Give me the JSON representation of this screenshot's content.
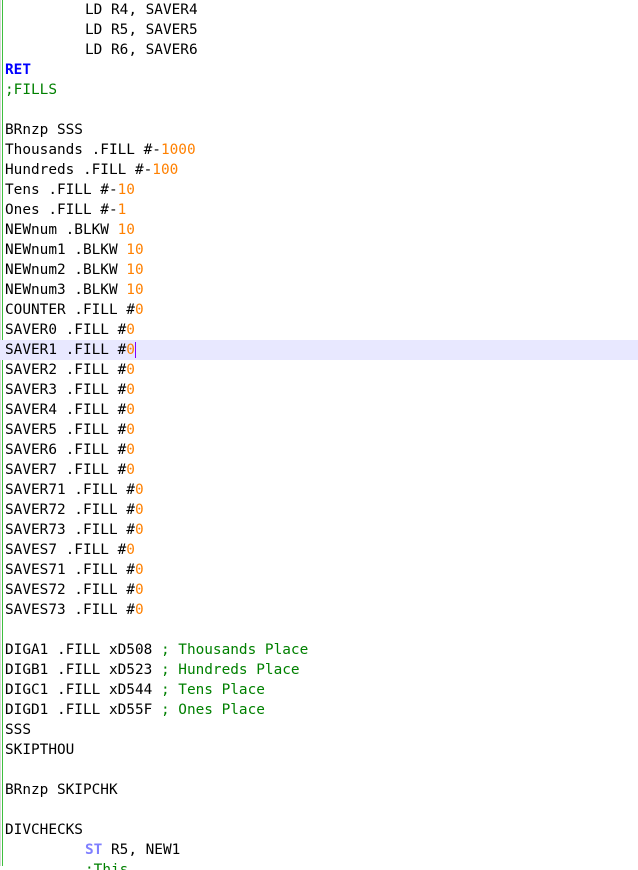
{
  "editor": {
    "theme": {
      "keyword": "#0000ff",
      "keyword_alt": "#8080ff",
      "comment": "#008000",
      "number": "#ff8000",
      "text": "#000000",
      "current_line": "#e8e8ff"
    },
    "lines": [
      {
        "indent": true,
        "text": "LD R4, SAVER4"
      },
      {
        "indent": true,
        "text": "LD R5, SAVER5"
      },
      {
        "indent": true,
        "text": "LD R6, SAVER6"
      },
      {
        "kw": "RET"
      },
      {
        "comment": ";FILLS"
      },
      {
        "text": ""
      },
      {
        "text": "BRnzp SSS"
      },
      {
        "text": "Thousands .FILL #-",
        "num": "1000"
      },
      {
        "text": "Hundreds .FILL #-",
        "num": "100"
      },
      {
        "text": "Tens .FILL #-",
        "num": "10"
      },
      {
        "text": "Ones .FILL #-",
        "num": "1"
      },
      {
        "text": "NEWnum .BLKW ",
        "num": "10"
      },
      {
        "text": "NEWnum1 .BLKW ",
        "num": "10"
      },
      {
        "text": "NEWnum2 .BLKW ",
        "num": "10"
      },
      {
        "text": "NEWnum3 .BLKW ",
        "num": "10"
      },
      {
        "text": "COUNTER .FILL #",
        "num": "0"
      },
      {
        "text": "SAVER0 .FILL #",
        "num": "0"
      },
      {
        "text": "SAVER1 .FILL #",
        "num": "0",
        "current": true
      },
      {
        "text": "SAVER2 .FILL #",
        "num": "0"
      },
      {
        "text": "SAVER3 .FILL #",
        "num": "0"
      },
      {
        "text": "SAVER4 .FILL #",
        "num": "0"
      },
      {
        "text": "SAVER5 .FILL #",
        "num": "0"
      },
      {
        "text": "SAVER6 .FILL #",
        "num": "0"
      },
      {
        "text": "SAVER7 .FILL #",
        "num": "0"
      },
      {
        "text": "SAVER71 .FILL #",
        "num": "0"
      },
      {
        "text": "SAVER72 .FILL #",
        "num": "0"
      },
      {
        "text": "SAVER73 .FILL #",
        "num": "0"
      },
      {
        "text": "SAVES7 .FILL #",
        "num": "0"
      },
      {
        "text": "SAVES71 .FILL #",
        "num": "0"
      },
      {
        "text": "SAVES72 .FILL #",
        "num": "0"
      },
      {
        "text": "SAVES73 .FILL #",
        "num": "0"
      },
      {
        "text": ""
      },
      {
        "text": "DIGA1 .FILL xD508 ",
        "comment": "; Thousands Place"
      },
      {
        "text": "DIGB1 .FILL xD523 ",
        "comment": "; Hundreds Place"
      },
      {
        "text": "DIGC1 .FILL xD544 ",
        "comment": "; Tens Place"
      },
      {
        "text": "DIGD1 .FILL xD55F ",
        "comment": "; Ones Place"
      },
      {
        "text": "SSS"
      },
      {
        "text": "SKIPTHOU"
      },
      {
        "text": ""
      },
      {
        "text": "BRnzp SKIPCHK"
      },
      {
        "text": ""
      },
      {
        "text": "DIVCHECKS"
      },
      {
        "indent": true,
        "kw2": "ST",
        "text": " R5, NEW1"
      },
      {
        "indent": true,
        "comment": ";This...",
        "partial": true
      }
    ]
  }
}
